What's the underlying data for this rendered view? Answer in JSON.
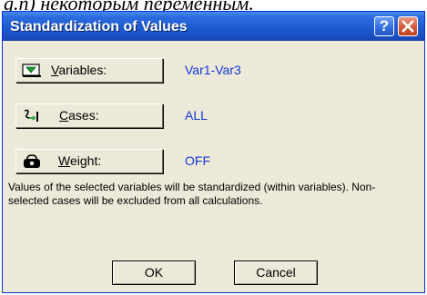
{
  "background_text": "g.n) некоторым переменным.",
  "window": {
    "title": "Standardization of Values",
    "help_glyph": "?",
    "colors": {
      "title_bar": "#1e5bd0",
      "value_text": "#1437d8",
      "dialog_bg": "#ece9d8"
    }
  },
  "rows": [
    {
      "icon": "variables-icon",
      "label_prefix": "",
      "label_hotkey": "V",
      "label_rest": "ariables:",
      "value": "Var1-Var3"
    },
    {
      "icon": "cases-icon",
      "label_prefix": "",
      "label_hotkey": "C",
      "label_rest": "ases:",
      "value": "ALL"
    },
    {
      "icon": "weight-icon",
      "label_prefix": "",
      "label_hotkey": "W",
      "label_rest": "eight:",
      "value": "OFF"
    }
  ],
  "description": "Values of the selected variables will be standardized (within variables). Non-selected cases will be excluded from all calculations.",
  "buttons": {
    "ok": "OK",
    "cancel": "Cancel"
  }
}
